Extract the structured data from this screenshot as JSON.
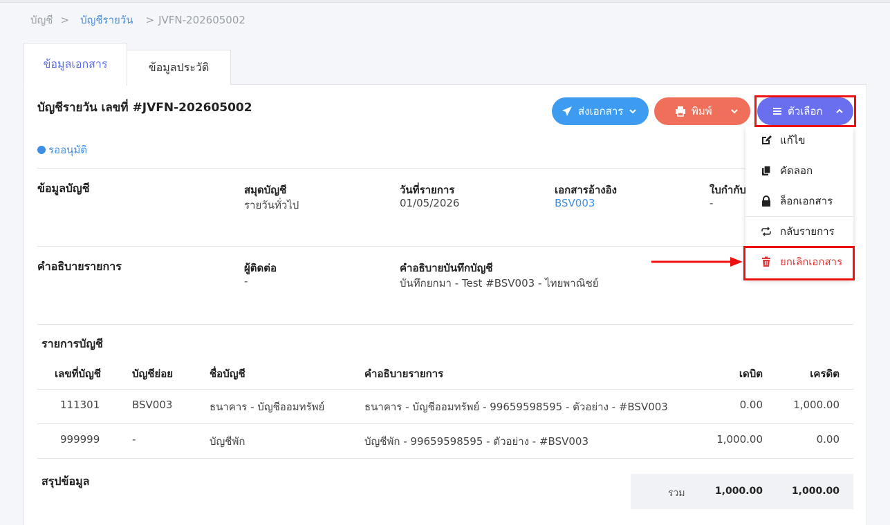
{
  "breadcrumb": {
    "root": "บัญชี",
    "sep": ">",
    "section": "บัญชีรายวัน",
    "current": "JVFN-202605002"
  },
  "tabs": {
    "document_info": "ข้อมูลเอกสาร",
    "history": "ข้อมูลประวัติ"
  },
  "document": {
    "title": "บัญชีรายวัน เลขที่ #JVFN-202605002",
    "status": "รออนุมัติ"
  },
  "actions": {
    "send_label": "ส่งเอกสาร",
    "print_label": "พิมพ์",
    "options_label": "ตัวเลือก"
  },
  "options_menu": {
    "edit": "แก้ไข",
    "copy": "คัดลอก",
    "lock": "ล็อกเอกสาร",
    "revert": "กลับรายการ",
    "cancel_doc": "ยกเลิกเอกสาร"
  },
  "account_info": {
    "section_title": "ข้อมูลบัญชี",
    "journal_label": "สมุดบัญชี",
    "journal_value": "รายวันทั่วไป",
    "date_label": "วันที่รายการ",
    "date_value": "01/05/2026",
    "ref_label": "เอกสารอ้างอิง",
    "ref_value": "BSV003",
    "tax_label": "ใบกำกับ",
    "tax_value": "-"
  },
  "description": {
    "section_title": "คำอธิบายรายการ",
    "contact_label": "ผู้ติดต่อ",
    "contact_value": "-",
    "note_label": "คำอธิบายบันทึกบัญชี",
    "note_value": "บันทึกยกมา - Test #BSV003 - ไทยพาณิชย์"
  },
  "entries": {
    "section_title": "รายการบัญชี",
    "headers": {
      "account_no": "เลขที่บัญชี",
      "sub_account": "บัญชีย่อย",
      "account_name": "ชื่อบัญชี",
      "description": "คำอธิบายรายการ",
      "debit": "เดบิต",
      "credit": "เครดิต"
    },
    "rows": [
      {
        "account_no": "111301",
        "sub_account": "BSV003",
        "account_name": "ธนาคาร - บัญชีออมทรัพย์",
        "description": "ธนาคาร - บัญชีออมทรัพย์ - 99659598595 - ตัวอย่าง - #BSV003",
        "debit": "0.00",
        "credit": "1,000.00"
      },
      {
        "account_no": "999999",
        "sub_account": "-",
        "account_name": "บัญชีพัก",
        "description": "บัญชีพัก - 99659598595 - ตัวอย่าง - #BSV003",
        "debit": "1,000.00",
        "credit": "0.00"
      }
    ]
  },
  "summary": {
    "section_title": "สรุปข้อมูล",
    "total_label": "รวม",
    "total_debit": "1,000.00",
    "total_credit": "1,000.00"
  },
  "colors": {
    "send": "#3d9cf0",
    "print": "#ef6f5a",
    "options": "#6a6ff0",
    "highlight": "#ee0f0f",
    "link": "#3f8fe6",
    "danger": "#e03a3a"
  },
  "icons": {
    "send": "paper-plane-icon",
    "print": "printer-icon",
    "options": "menu-bars-icon",
    "edit": "edit-icon",
    "copy": "copy-icon",
    "lock": "lock-icon",
    "revert": "repeat-icon",
    "cancel_doc": "trash-icon"
  }
}
